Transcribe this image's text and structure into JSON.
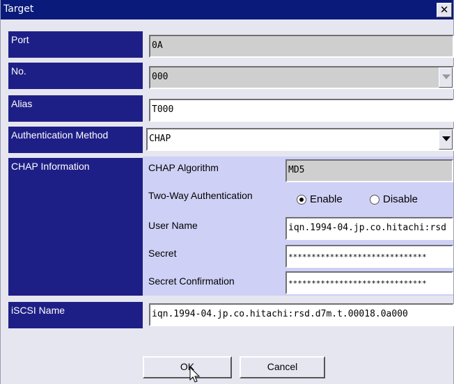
{
  "window": {
    "title": "Target",
    "close_glyph": "✕"
  },
  "fields": {
    "port": {
      "label": "Port",
      "value": "0A"
    },
    "no": {
      "label": "No.",
      "value": "000"
    },
    "alias": {
      "label": "Alias",
      "value": "T000"
    },
    "auth_method": {
      "label": "Authentication Method",
      "value": "CHAP"
    },
    "chap": {
      "label": "CHAP Information",
      "algorithm_label": "CHAP Algorithm",
      "algorithm_value": "MD5",
      "two_way_label": "Two-Way Authentication",
      "enable_label": "Enable",
      "disable_label": "Disable",
      "two_way_selected": "Enable",
      "user_name_label": "User Name",
      "user_name_value": "iqn.1994-04.jp.co.hitachi:rsd",
      "secret_label": "Secret",
      "secret_value": "******************************",
      "secret_confirm_label": "Secret Confirmation",
      "secret_confirm_value": "******************************"
    },
    "iscsi_name": {
      "label": "iSCSI Name",
      "value": "iqn.1994-04.jp.co.hitachi:rsd.d7m.t.00018.0a000"
    }
  },
  "buttons": {
    "ok": "OK",
    "cancel": "Cancel"
  }
}
